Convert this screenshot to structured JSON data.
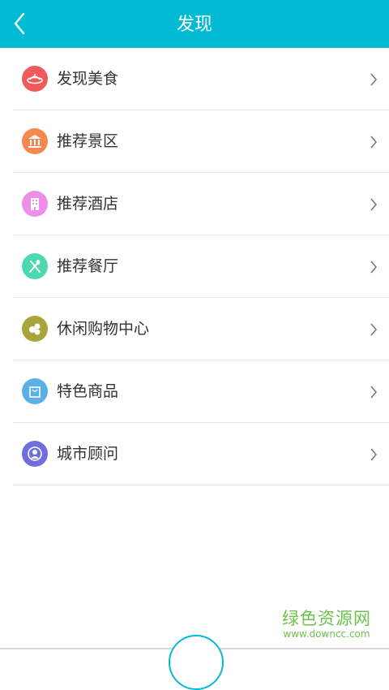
{
  "header": {
    "title": "发现",
    "back_icon": "back-arrow-icon",
    "bg_color": "#00bbd3"
  },
  "items": [
    {
      "label": "发现美食",
      "icon": "food-plate-icon",
      "color": "#f05a5a"
    },
    {
      "label": "推荐景区",
      "icon": "landmark-icon",
      "color": "#f5874f"
    },
    {
      "label": "推荐酒店",
      "icon": "hotel-building-icon",
      "color": "#ee8ee8"
    },
    {
      "label": "推荐餐厅",
      "icon": "utensils-icon",
      "color": "#4ed8b2"
    },
    {
      "label": "休闲购物中心",
      "icon": "shopping-center-icon",
      "color": "#a8a63b"
    },
    {
      "label": "特色商品",
      "icon": "shopping-bag-icon",
      "color": "#5cb0e8"
    },
    {
      "label": "城市顾问",
      "icon": "advisor-person-icon",
      "color": "#6f6ee0"
    }
  ],
  "watermark": {
    "title": "绿色资源网",
    "subtitle": "www.downcc.com"
  }
}
